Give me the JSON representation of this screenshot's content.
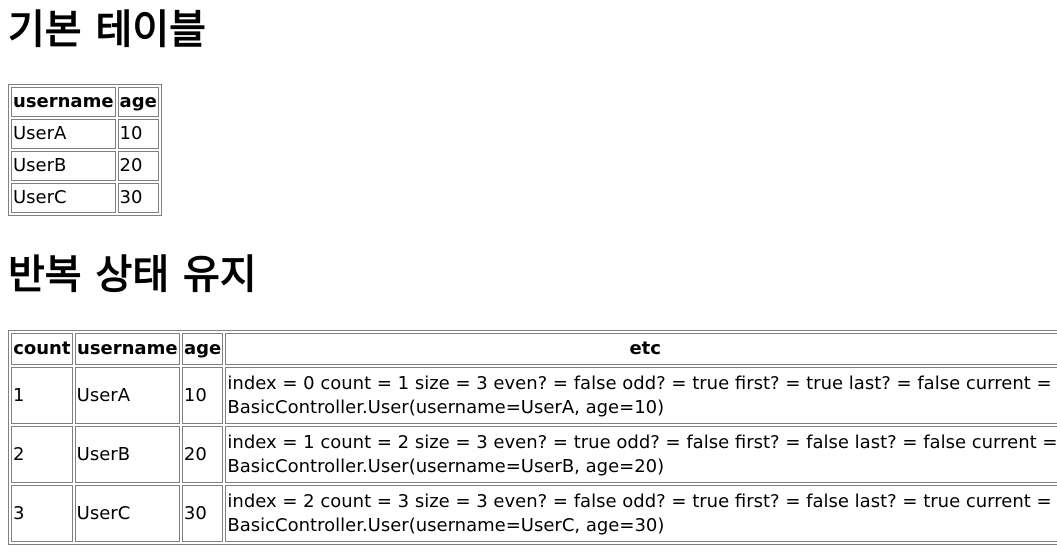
{
  "basic_section": {
    "title": "기본 테이블",
    "headers": [
      "username",
      "age"
    ],
    "rows": [
      {
        "username": "UserA",
        "age": "10"
      },
      {
        "username": "UserB",
        "age": "20"
      },
      {
        "username": "UserC",
        "age": "30"
      }
    ]
  },
  "iter_section": {
    "title": "반복 상태 유지",
    "headers": [
      "count",
      "username",
      "age",
      "etc"
    ],
    "rows": [
      {
        "count": "1",
        "username": "UserA",
        "age": "10",
        "etc_line1": "index = 0 count = 1 size = 3 even? = false odd? = true first? = true last? = false current =",
        "etc_line2": "BasicController.User(username=UserA, age=10)"
      },
      {
        "count": "2",
        "username": "UserB",
        "age": "20",
        "etc_line1": "index = 1 count = 2 size = 3 even? = true odd? = false first? = false last? = false current =",
        "etc_line2": "BasicController.User(username=UserB, age=20)"
      },
      {
        "count": "3",
        "username": "UserC",
        "age": "30",
        "etc_line1": "index = 2 count = 3 size = 3 even? = false odd? = true first? = false last? = true current =",
        "etc_line2": "BasicController.User(username=UserC, age=30)"
      }
    ]
  }
}
